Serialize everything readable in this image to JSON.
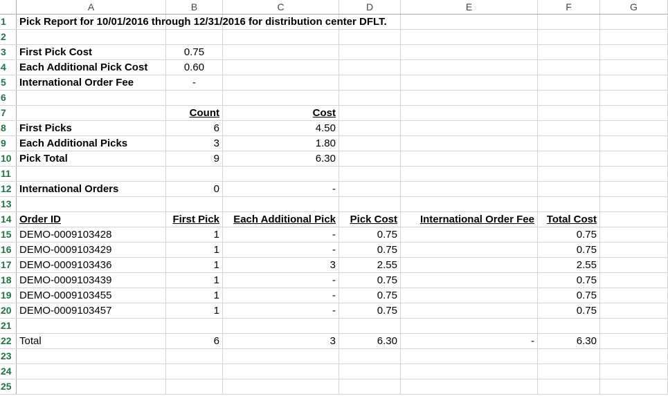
{
  "columns": [
    "A",
    "B",
    "C",
    "D",
    "E",
    "F",
    "G"
  ],
  "row_numbers": [
    "1",
    "2",
    "3",
    "4",
    "5",
    "6",
    "7",
    "8",
    "9",
    "10",
    "11",
    "12",
    "13",
    "14",
    "15",
    "16",
    "17",
    "18",
    "19",
    "20",
    "21",
    "22",
    "23",
    "24",
    "25"
  ],
  "title": "Pick Report for 10/01/2016 through 12/31/2016 for distribution center DFLT.",
  "settings": {
    "first_pick_cost_label": "First Pick Cost",
    "first_pick_cost_value": "0.75",
    "additional_pick_cost_label": "Each Additional Pick Cost",
    "additional_pick_cost_value": "0.60",
    "intl_fee_label": "International Order Fee",
    "intl_fee_value": "-"
  },
  "summary": {
    "count_header": "Count",
    "cost_header": "Cost",
    "rows": [
      {
        "label": "First Picks",
        "count": "6",
        "cost": "4.50"
      },
      {
        "label": "Each Additional Picks",
        "count": "3",
        "cost": "1.80"
      },
      {
        "label": "Pick Total",
        "count": "9",
        "cost": "6.30"
      }
    ],
    "intl_orders_label": "International Orders",
    "intl_orders_count": "0",
    "intl_orders_cost": "-"
  },
  "orders": {
    "headers": [
      "Order ID",
      "First Pick",
      "Each Additional Pick",
      "Pick Cost",
      "International Order Fee",
      "Total Cost"
    ],
    "rows": [
      {
        "id": "DEMO-0009103428",
        "first": "1",
        "additional": "-",
        "pick_cost": "0.75",
        "intl_fee": "",
        "total": "0.75"
      },
      {
        "id": "DEMO-0009103429",
        "first": "1",
        "additional": "-",
        "pick_cost": "0.75",
        "intl_fee": "",
        "total": "0.75"
      },
      {
        "id": "DEMO-0009103436",
        "first": "1",
        "additional": "3",
        "pick_cost": "2.55",
        "intl_fee": "",
        "total": "2.55"
      },
      {
        "id": "DEMO-0009103439",
        "first": "1",
        "additional": "-",
        "pick_cost": "0.75",
        "intl_fee": "",
        "total": "0.75"
      },
      {
        "id": "DEMO-0009103455",
        "first": "1",
        "additional": "-",
        "pick_cost": "0.75",
        "intl_fee": "",
        "total": "0.75"
      },
      {
        "id": "DEMO-0009103457",
        "first": "1",
        "additional": "-",
        "pick_cost": "0.75",
        "intl_fee": "",
        "total": "0.75"
      }
    ],
    "total": {
      "label": "Total",
      "first": "6",
      "additional": "3",
      "pick_cost": "6.30",
      "intl_fee": "-",
      "total": "6.30"
    }
  }
}
